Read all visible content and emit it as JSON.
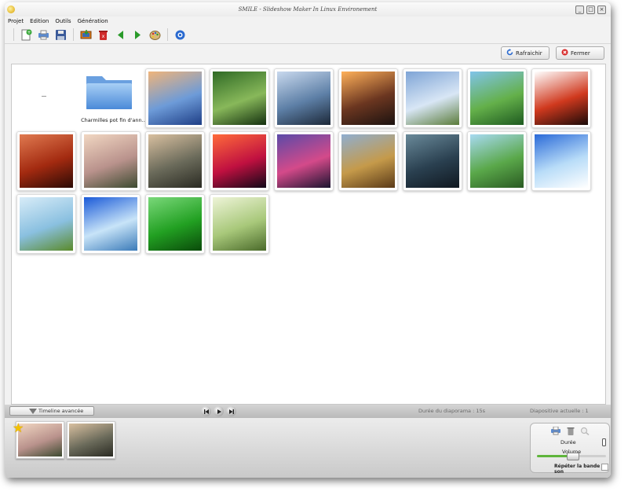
{
  "window": {
    "title": "SMILE - Slideshow Maker In Linux Environement"
  },
  "menu": [
    "Projet",
    "Edition",
    "Outils",
    "Génération"
  ],
  "toolbar": {
    "icons": [
      "new-project-icon",
      "print-icon",
      "save-icon",
      "import-images-icon",
      "delete-icon",
      "previous-arrow-icon",
      "next-arrow-icon",
      "paint-palette-icon",
      "about-icon"
    ]
  },
  "actions": {
    "refresh_label": "Rafraichir",
    "close_label": "Fermer"
  },
  "gallery": {
    "folder_label": "Charmilles pot fin d'ann...",
    "images": [
      {
        "name": "lake-reflection-dawn",
        "colors": [
          "#f0b47a",
          "#6d9bd8",
          "#1e3e86"
        ]
      },
      {
        "name": "green-leaves-ladybug",
        "colors": [
          "#2f6a25",
          "#88b85a",
          "#14300f"
        ]
      },
      {
        "name": "misty-coast-rocks",
        "colors": [
          "#c9d9ee",
          "#5d7fa6",
          "#1c2838"
        ]
      },
      {
        "name": "waterfall-sunset",
        "colors": [
          "#ffb15a",
          "#6b3620",
          "#1b1210"
        ]
      },
      {
        "name": "lighthouse",
        "colors": [
          "#7ea4d6",
          "#d8e6f5",
          "#5b7c3a"
        ]
      },
      {
        "name": "green-valley",
        "colors": [
          "#80c4ea",
          "#64b04a",
          "#1e5a20"
        ]
      },
      {
        "name": "red-abstract-hand",
        "colors": [
          "#ffffff",
          "#d0391e",
          "#1a0a08"
        ]
      },
      {
        "name": "red-fantasy",
        "colors": [
          "#e07a50",
          "#a32a10",
          "#2b0a05"
        ]
      },
      {
        "name": "girl-with-flowers",
        "colors": [
          "#f1d7c2",
          "#b9928c",
          "#3c4a30"
        ]
      },
      {
        "name": "woman-red-dress",
        "colors": [
          "#d9c0a0",
          "#6a6a5a",
          "#2a2a22"
        ]
      },
      {
        "name": "light-waves",
        "colors": [
          "#ff6b3a",
          "#c01040",
          "#100818"
        ]
      },
      {
        "name": "purple-night-figure",
        "colors": [
          "#5a4aa8",
          "#d44a8a",
          "#1a1430"
        ]
      },
      {
        "name": "golden-field-houses",
        "colors": [
          "#8faed0",
          "#c59a4a",
          "#5a3a18"
        ]
      },
      {
        "name": "car-storm",
        "colors": [
          "#6a8a9a",
          "#2a4050",
          "#101820"
        ]
      },
      {
        "name": "green-path-trees",
        "colors": [
          "#a8daf2",
          "#5aa84a",
          "#2a5a22"
        ]
      },
      {
        "name": "winter-blue-forest",
        "colors": [
          "#2a6ad8",
          "#b8dcf8",
          "#ffffff"
        ]
      },
      {
        "name": "green-meadow-sky",
        "colors": [
          "#d8ecf8",
          "#8ac0e0",
          "#5a8a2a"
        ]
      },
      {
        "name": "ice-lake",
        "colors": [
          "#1a5ad8",
          "#c8e4f8",
          "#3a7ab8"
        ]
      },
      {
        "name": "green-gradient",
        "colors": [
          "#7ad87a",
          "#22a022",
          "#0a4a0a"
        ]
      },
      {
        "name": "bamboo-bokeh",
        "colors": [
          "#eef4d8",
          "#a8c87a",
          "#4a6a2a"
        ]
      }
    ]
  },
  "status": {
    "timeline_label": "Timeline avancée",
    "duration_text": "Durée du diaporama : 15s",
    "current_slide_text": "Diapositive actuelle : 1"
  },
  "timeline": {
    "slides": [
      {
        "name": "girl-with-flowers",
        "colors": [
          "#f1d7c2",
          "#b9928c",
          "#3c4a30"
        ]
      },
      {
        "name": "woman-red-dress",
        "colors": [
          "#d9c0a0",
          "#6a6a5a",
          "#2a2a22"
        ]
      }
    ]
  },
  "audio": {
    "duration_label": "Durée",
    "volume_label": "Volume",
    "volume_level": 0.5,
    "repeat_label": "Répéter la bande son"
  }
}
